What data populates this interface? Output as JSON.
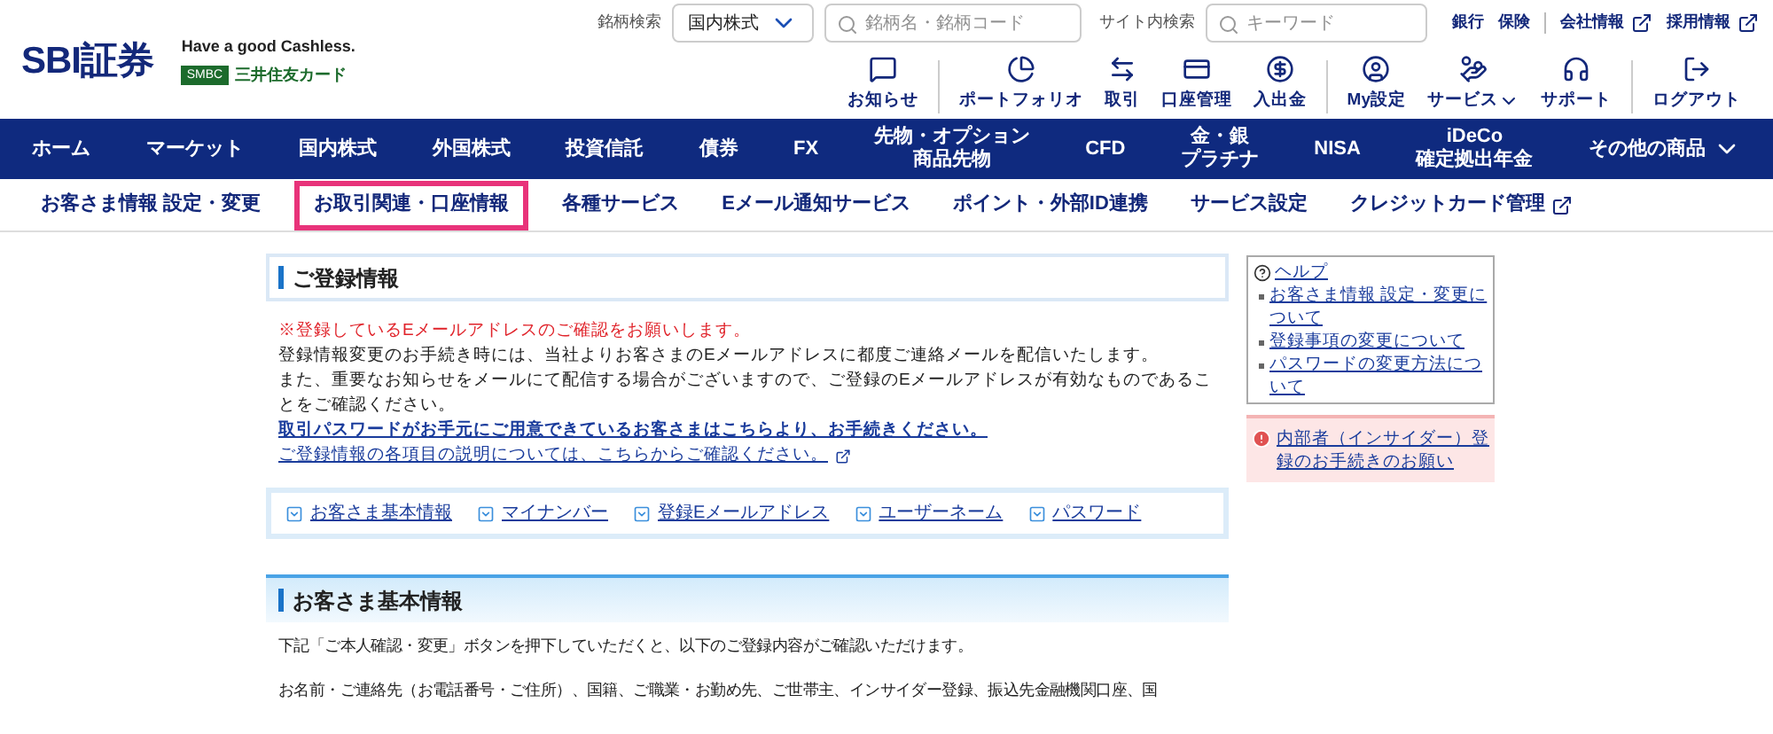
{
  "header": {
    "logo": "SBI証券",
    "tagline": "Have a good Cashless.",
    "card_badge": "SMBC",
    "card_name": "三井住友カード",
    "stock_search_label": "銘柄検索",
    "market_select": "国内株式",
    "stock_search": {
      "placeholder": "銘柄名・銘柄コード"
    },
    "site_search_label": "サイト内検索",
    "site_search": {
      "placeholder": "キーワード"
    },
    "top_links": [
      {
        "label": "銀行",
        "external": false
      },
      {
        "label": "保険",
        "external": false
      },
      {
        "label": "会社情報",
        "external": true
      },
      {
        "label": "採用情報",
        "external": true
      }
    ],
    "icon_menu": [
      {
        "label": "お知らせ",
        "dropdown": false
      },
      {
        "label": "ポートフォリオ",
        "dropdown": false
      },
      {
        "label": "取引",
        "dropdown": false
      },
      {
        "label": "口座管理",
        "dropdown": false
      },
      {
        "label": "入出金",
        "dropdown": false
      },
      {
        "label": "My設定",
        "dropdown": false
      },
      {
        "label": "サービス",
        "dropdown": true
      },
      {
        "label": "サポート",
        "dropdown": false
      },
      {
        "label": "ログアウト",
        "dropdown": false
      }
    ]
  },
  "main_nav": [
    {
      "lines": [
        "ホーム"
      ],
      "dropdown": false
    },
    {
      "lines": [
        "マーケット"
      ],
      "dropdown": false
    },
    {
      "lines": [
        "国内株式"
      ],
      "dropdown": false
    },
    {
      "lines": [
        "外国株式"
      ],
      "dropdown": false
    },
    {
      "lines": [
        "投資信託"
      ],
      "dropdown": false
    },
    {
      "lines": [
        "債券"
      ],
      "dropdown": false
    },
    {
      "lines": [
        "FX"
      ],
      "dropdown": false
    },
    {
      "lines": [
        "先物・オプション",
        "商品先物"
      ],
      "dropdown": false
    },
    {
      "lines": [
        "CFD"
      ],
      "dropdown": false
    },
    {
      "lines": [
        "金・銀",
        "プラチナ"
      ],
      "dropdown": false
    },
    {
      "lines": [
        "NISA"
      ],
      "dropdown": false
    },
    {
      "lines": [
        "iDeCo",
        "確定拠出年金"
      ],
      "dropdown": false
    },
    {
      "lines": [
        "その他の商品"
      ],
      "dropdown": true
    }
  ],
  "sub_nav": [
    {
      "label": "お客さま情報 設定・変更",
      "selected": false,
      "external": false
    },
    {
      "label": "お取引関連・口座情報",
      "selected": true,
      "external": false
    },
    {
      "label": "各種サービス",
      "selected": false,
      "external": false
    },
    {
      "label": "Eメール通知サービス",
      "selected": false,
      "external": false
    },
    {
      "label": "ポイント・外部ID連携",
      "selected": false,
      "external": false
    },
    {
      "label": "サービス設定",
      "selected": false,
      "external": false
    },
    {
      "label": "クレジットカード管理",
      "selected": false,
      "external": true
    }
  ],
  "registration": {
    "title": "ご登録情報",
    "notice": "※登録しているEメールアドレスのご確認をお願いします。",
    "paragraphs": [
      "登録情報変更のお手続き時には、当社よりお客さまのEメールアドレスに都度ご連絡メールを配信いたします。",
      "また、重要なお知らせをメールにて配信する場合がございますので、ご登録のEメールアドレスが有効なものであることをご確認ください。"
    ],
    "links": [
      {
        "text": "取引パスワードがお手元にご用意できているお客さまはこちらより、お手続きください。",
        "bold": true,
        "external": false
      },
      {
        "text": "ご登録情報の各項目の説明については、こちらからご確認ください。",
        "bold": false,
        "external": true
      }
    ],
    "anchors": [
      "お客さま基本情報",
      "マイナンバー",
      "登録Eメールアドレス",
      "ユーザーネーム",
      "パスワード"
    ]
  },
  "basic_info": {
    "title": "お客さま基本情報",
    "paragraphs": [
      "下記「ご本人確認・変更」ボタンを押下していただくと、以下のご登録内容がご確認いただけます。",
      "お名前・ご連絡先（お電話番号・ご住所）、国籍、ご職業・お勤め先、ご世帯主、インサイダー登録、振込先金融機関口座、国"
    ]
  },
  "sidebar": {
    "help_label": "ヘルプ",
    "help_links": [
      "お客さま情報 設定・変更について",
      "登録事項の変更について",
      "パスワードの変更方法について"
    ],
    "alert_link": "内部者（インサイダー）登録のお手続きのお願い"
  }
}
